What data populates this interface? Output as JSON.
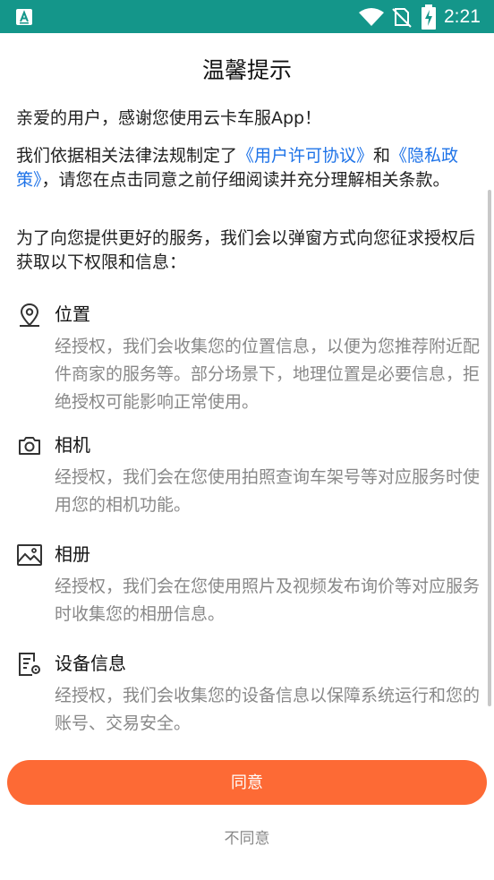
{
  "status_bar": {
    "time": "2:21",
    "background": "#14968a",
    "icons": [
      "app-notification-icon",
      "wifi-icon",
      "no-sim-icon",
      "battery-charging-icon"
    ]
  },
  "dialog": {
    "title": "温馨提示",
    "greeting": "亲爱的用户，感谢您使用云卡车服App！",
    "policy_prefix": "我们依据相关法律法规制定了",
    "user_agreement": "《用户许可协议》",
    "policy_and": "和",
    "privacy_policy": "《隐私政策》",
    "policy_suffix": "，请您在点击同意之前仔细阅读并充分理解相关条款。",
    "intro": "为了向您提供更好的服务，我们会以弹窗方式向您征求授权后获取以下权限和信息：",
    "link_color": "#1e73e8",
    "permissions": [
      {
        "icon": "location-pin-icon",
        "title": "位置",
        "desc": "经授权，我们会收集您的位置信息，以便为您推荐附近配件商家的服务等。部分场景下，地理位置是必要信息，拒绝授权可能影响正常使用。"
      },
      {
        "icon": "camera-icon",
        "title": "相机",
        "desc": "经授权，我们会在您使用拍照查询车架号等对应服务时使用您的相机功能。"
      },
      {
        "icon": "photo-album-icon",
        "title": "相册",
        "desc": "经授权，我们会在您使用照片及视频发布询价等对应服务时收集您的相册信息。"
      },
      {
        "icon": "device-info-icon",
        "title": "设备信息",
        "desc": "经授权，我们会收集您的设备信息以保障系统运行和您的账号、交易安全。"
      }
    ]
  },
  "actions": {
    "agree_label": "同意",
    "disagree_label": "不同意",
    "agree_color": "#fd6a35"
  }
}
